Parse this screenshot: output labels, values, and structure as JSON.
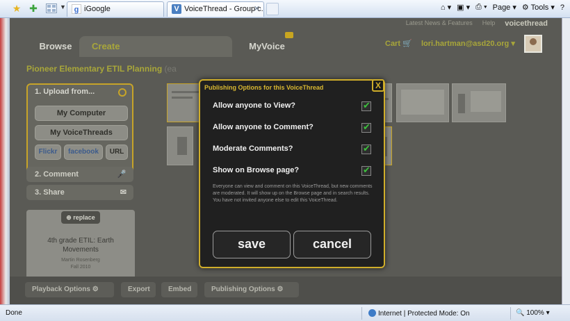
{
  "browser": {
    "tabs": [
      {
        "label": "iGoogle"
      },
      {
        "label": "VoiceThread - Group c..."
      }
    ],
    "tools": {
      "page_label": "Page",
      "tools_label": "Tools"
    }
  },
  "app": {
    "top_links": [
      "Latest News & Features",
      "Help",
      "voicethread"
    ],
    "nav": {
      "browse": "Browse",
      "create": "Create",
      "myvoice": "MyVoice"
    },
    "cart": "Cart",
    "user_email": "lori.hartman@asd20.org",
    "project_title": "Pioneer Elementary ETIL Planning",
    "project_suffix": "(ea",
    "steps": {
      "upload_title": "1. Upload from...",
      "my_computer": "My Computer",
      "my_voicethreads": "My VoiceThreads",
      "flickr": "Flickr",
      "facebook": "facebook",
      "url": "URL",
      "comment": "2. Comment",
      "share": "3. Share"
    },
    "card": {
      "replace": "replace",
      "title": "4th grade ETIL: Earth Movements",
      "subtitle_line1": "Martin Rosenberg",
      "subtitle_line2": "Fall 2010"
    },
    "bottom": {
      "playback": "Playback Options",
      "export": "Export",
      "embed": "Embed",
      "publishing": "Publishing Options"
    }
  },
  "modal": {
    "title": "Publishing Options for this VoiceThread",
    "options": [
      {
        "label": "Allow anyone to View?",
        "checked": true
      },
      {
        "label": "Allow anyone to Comment?",
        "checked": true
      },
      {
        "label": "Moderate Comments?",
        "checked": true
      },
      {
        "label": "Show on Browse page?",
        "checked": true
      }
    ],
    "description": "Everyone can view and comment on this VoiceThread, but new comments are moderated. It will show up on the Browse page and in search results. You have not invited anyone else to edit this VoiceThread.",
    "save": "save",
    "cancel": "cancel",
    "close": "X"
  },
  "statusbar": {
    "left": "Done",
    "zone": "Internet | Protected Mode: On",
    "zoom": "100%"
  }
}
